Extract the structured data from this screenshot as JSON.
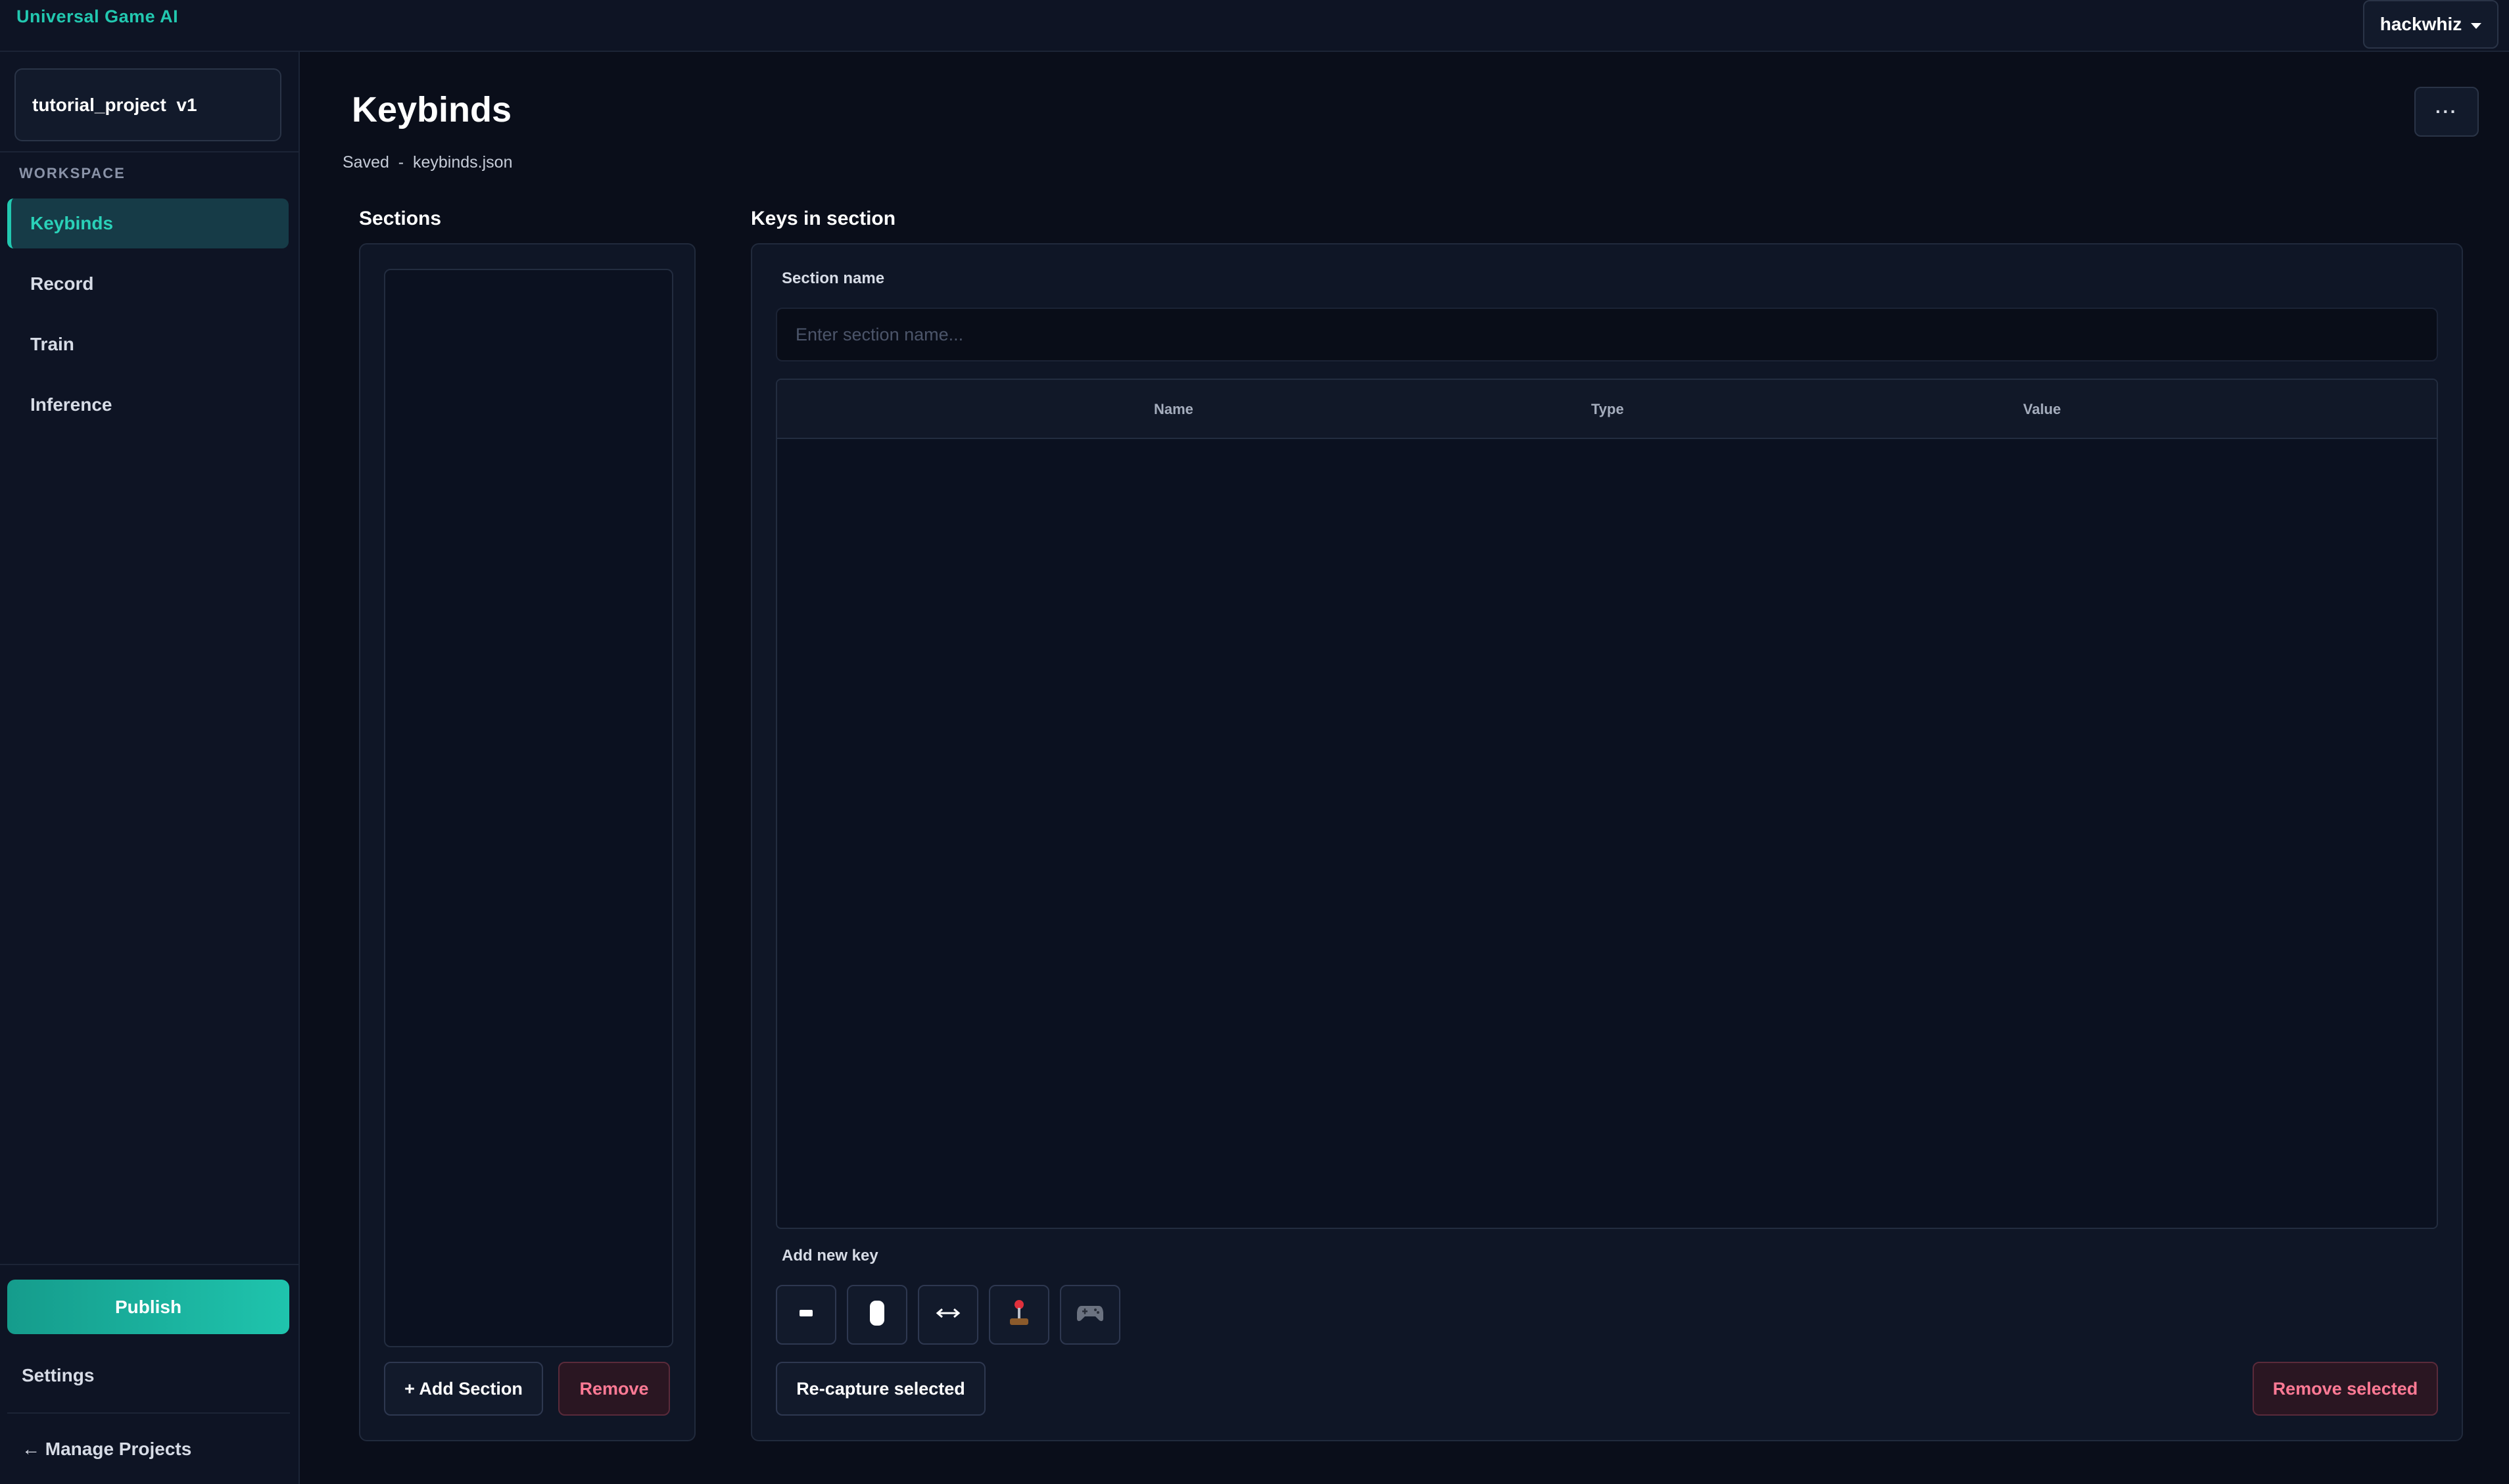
{
  "app": {
    "title": "Universal Game AI"
  },
  "user": {
    "name": "hackwhiz"
  },
  "sidebar": {
    "project_label": "tutorial_project  v1",
    "workspace_label": "WORKSPACE",
    "items": [
      {
        "label": "Keybinds",
        "active": true
      },
      {
        "label": "Record",
        "active": false
      },
      {
        "label": "Train",
        "active": false
      },
      {
        "label": "Inference",
        "active": false
      }
    ],
    "publish_label": "Publish",
    "settings_label": "Settings",
    "manage_label": "← Manage Projects"
  },
  "page": {
    "title": "Keybinds",
    "more_label": "···",
    "save_status": "Saved  -  keybinds.json"
  },
  "sections": {
    "heading": "Sections",
    "add_label": "+ Add Section",
    "remove_label": "Remove"
  },
  "keys": {
    "heading": "Keys in section",
    "section_name_label": "Section name",
    "section_name_value": "",
    "section_name_placeholder": "Enter section name...",
    "columns": [
      "Name",
      "Type",
      "Value"
    ],
    "rows": [],
    "add_new_key_label": "Add new key",
    "key_types": [
      {
        "icon": "keyboard-key-icon"
      },
      {
        "icon": "mouse-icon"
      },
      {
        "icon": "horizontal-arrows-icon"
      },
      {
        "icon": "joystick-icon"
      },
      {
        "icon": "gamepad-icon"
      }
    ],
    "recapture_label": "Re-capture selected",
    "remove_selected_label": "Remove selected"
  },
  "colors": {
    "accent": "#22c8b0",
    "danger": "#ff7a95",
    "background": "#0a0e1a"
  }
}
